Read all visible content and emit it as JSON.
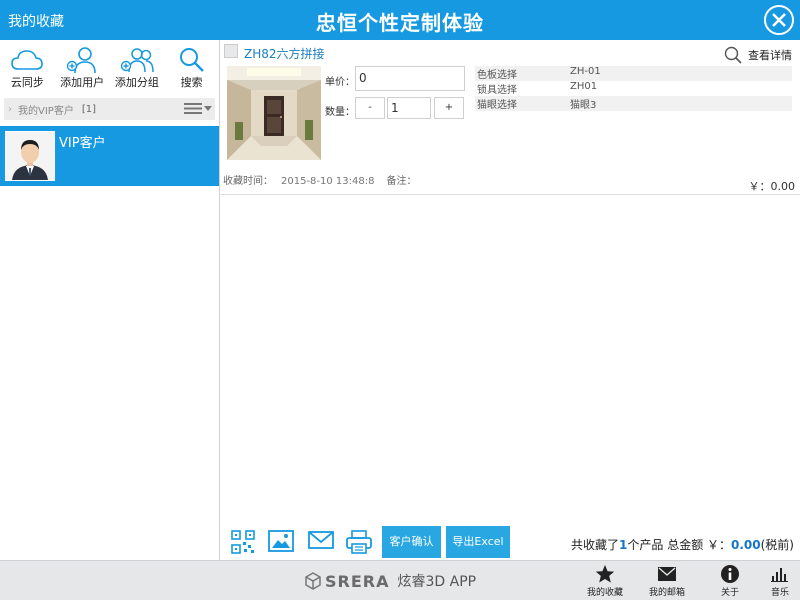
{
  "header": {
    "back_label": "我的收藏",
    "title": "忠恒个性定制体验"
  },
  "sidebar": {
    "tools": [
      {
        "label": "云同步",
        "icon": "cloud-icon"
      },
      {
        "label": "添加用户",
        "icon": "add-user-icon"
      },
      {
        "label": "添加分组",
        "icon": "add-group-icon"
      },
      {
        "label": "搜索",
        "icon": "search-icon"
      }
    ],
    "group": {
      "name": "我的VIP客户",
      "count": "[1]"
    },
    "customers": [
      {
        "name": "VIP客户"
      }
    ]
  },
  "product": {
    "name": "ZH82六方拼接",
    "detail_label": "查看详情",
    "price_label": "单价：",
    "price_value": "0",
    "qty_label": "数量：",
    "qty_minus": "-",
    "qty_value": "1",
    "qty_plus": "+",
    "options": [
      {
        "key": "色板选择",
        "value": "ZH-01"
      },
      {
        "key": "锁具选择",
        "value": "ZH01"
      },
      {
        "key": "猫眼选择",
        "value": "猫眼3"
      }
    ],
    "time_label": "收藏时间：",
    "time_value": "2015-8-10 13:48:8",
    "note_label": "备注：",
    "subtotal": "￥：0.00"
  },
  "actions": {
    "icons": [
      "qr-code-icon",
      "image-icon",
      "mail-icon",
      "print-icon"
    ],
    "confirm_label": "客户确认",
    "export_label": "导出Excel",
    "totals_prefix": "共收藏了",
    "totals_count": "1",
    "totals_middle": "个产品 总金额 ￥：",
    "totals_amount": "0.00",
    "totals_suffix": "(税前)"
  },
  "footer": {
    "brand_en": "SRERA",
    "brand_cn": "炫睿3D APP",
    "tabs": [
      {
        "label": "我的收藏",
        "icon": "star-icon"
      },
      {
        "label": "我的邮箱",
        "icon": "mail-icon"
      },
      {
        "label": "关于",
        "icon": "info-icon"
      },
      {
        "label": "音乐",
        "icon": "music-bars-icon"
      }
    ]
  },
  "colors": {
    "accent": "#1699e0",
    "button": "#29a7e3",
    "footer_bg": "#e5e7e9"
  }
}
